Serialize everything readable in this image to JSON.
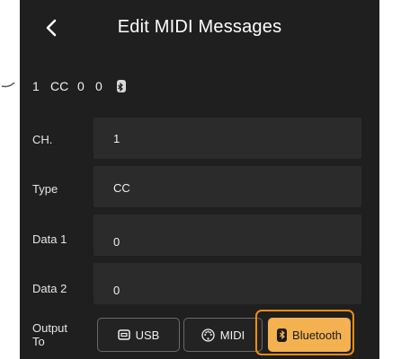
{
  "header": {
    "title": "Edit MIDI Messages"
  },
  "summary": {
    "channel": "1",
    "type": "CC",
    "data1": "0",
    "data2": "0"
  },
  "fields": [
    {
      "label": "CH.",
      "value": "1"
    },
    {
      "label": "Type",
      "value": "CC"
    },
    {
      "label": "Data 1",
      "value": "0"
    },
    {
      "label": "Data 2",
      "value": "0"
    }
  ],
  "output": {
    "label_line1": "Output",
    "label_line2": "To",
    "buttons": [
      {
        "label": "USB",
        "icon": "usb-icon",
        "selected": false
      },
      {
        "label": "MIDI",
        "icon": "midi-din-icon",
        "selected": false
      },
      {
        "label": "Bluetooth",
        "icon": "bluetooth-icon",
        "selected": true
      }
    ]
  },
  "colors": {
    "background": "#1f1f1f",
    "field": "#2b2b2b",
    "accent": "#f3b14f",
    "highlight": "#f08c12"
  }
}
